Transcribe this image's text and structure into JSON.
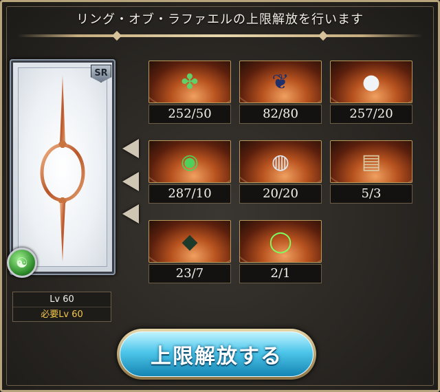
{
  "title": "リング・オブ・ラファエルの上限解放を行います",
  "card": {
    "rarity": "SR",
    "element_icon": "wind-element-icon",
    "level_label": "Lv 60",
    "required_level_label": "必要Lv 60"
  },
  "materials": [
    {
      "name": "green-leaf-icon",
      "count": "252/50"
    },
    {
      "name": "olive-branch-icon",
      "count": "82/80"
    },
    {
      "name": "crystal-orb-icon",
      "count": "257/20"
    },
    {
      "name": "green-eye-orb-icon",
      "count": "287/10"
    },
    {
      "name": "spirit-orb-icon",
      "count": "20/20"
    },
    {
      "name": "scroll-icon",
      "count": "5/3"
    },
    {
      "name": "dark-shard-icon",
      "count": "23/7"
    },
    {
      "name": "green-ring-icon",
      "count": "2/1"
    }
  ],
  "button": {
    "label": "上限解放する"
  },
  "colors": {
    "accent": "#4ec6ea",
    "required_level": "#f0c64a"
  }
}
